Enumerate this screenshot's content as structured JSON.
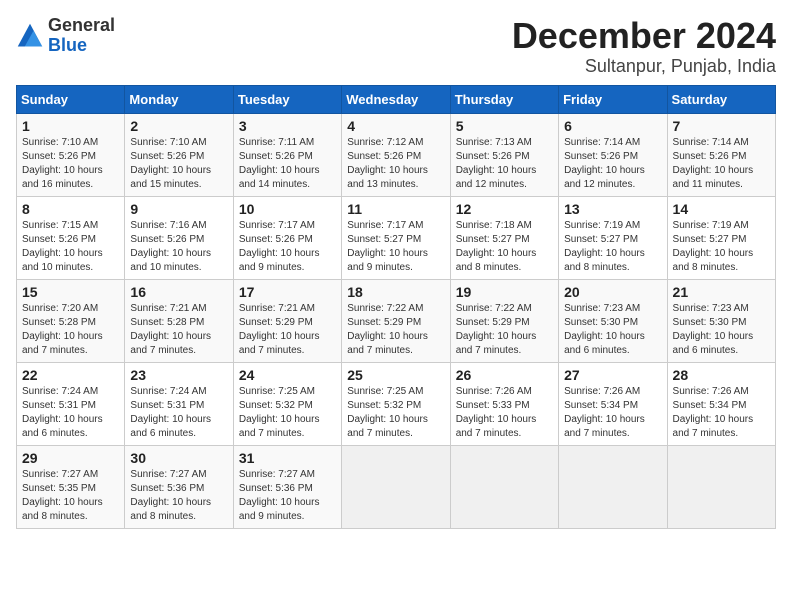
{
  "logo": {
    "general": "General",
    "blue": "Blue"
  },
  "header": {
    "month": "December 2024",
    "location": "Sultanpur, Punjab, India"
  },
  "weekdays": [
    "Sunday",
    "Monday",
    "Tuesday",
    "Wednesday",
    "Thursday",
    "Friday",
    "Saturday"
  ],
  "weeks": [
    [
      {
        "day": "1",
        "sunrise": "7:10 AM",
        "sunset": "5:26 PM",
        "daylight": "10 hours and 16 minutes."
      },
      {
        "day": "2",
        "sunrise": "7:10 AM",
        "sunset": "5:26 PM",
        "daylight": "10 hours and 15 minutes."
      },
      {
        "day": "3",
        "sunrise": "7:11 AM",
        "sunset": "5:26 PM",
        "daylight": "10 hours and 14 minutes."
      },
      {
        "day": "4",
        "sunrise": "7:12 AM",
        "sunset": "5:26 PM",
        "daylight": "10 hours and 13 minutes."
      },
      {
        "day": "5",
        "sunrise": "7:13 AM",
        "sunset": "5:26 PM",
        "daylight": "10 hours and 12 minutes."
      },
      {
        "day": "6",
        "sunrise": "7:14 AM",
        "sunset": "5:26 PM",
        "daylight": "10 hours and 12 minutes."
      },
      {
        "day": "7",
        "sunrise": "7:14 AM",
        "sunset": "5:26 PM",
        "daylight": "10 hours and 11 minutes."
      }
    ],
    [
      {
        "day": "8",
        "sunrise": "7:15 AM",
        "sunset": "5:26 PM",
        "daylight": "10 hours and 10 minutes."
      },
      {
        "day": "9",
        "sunrise": "7:16 AM",
        "sunset": "5:26 PM",
        "daylight": "10 hours and 10 minutes."
      },
      {
        "day": "10",
        "sunrise": "7:17 AM",
        "sunset": "5:26 PM",
        "daylight": "10 hours and 9 minutes."
      },
      {
        "day": "11",
        "sunrise": "7:17 AM",
        "sunset": "5:27 PM",
        "daylight": "10 hours and 9 minutes."
      },
      {
        "day": "12",
        "sunrise": "7:18 AM",
        "sunset": "5:27 PM",
        "daylight": "10 hours and 8 minutes."
      },
      {
        "day": "13",
        "sunrise": "7:19 AM",
        "sunset": "5:27 PM",
        "daylight": "10 hours and 8 minutes."
      },
      {
        "day": "14",
        "sunrise": "7:19 AM",
        "sunset": "5:27 PM",
        "daylight": "10 hours and 8 minutes."
      }
    ],
    [
      {
        "day": "15",
        "sunrise": "7:20 AM",
        "sunset": "5:28 PM",
        "daylight": "10 hours and 7 minutes."
      },
      {
        "day": "16",
        "sunrise": "7:21 AM",
        "sunset": "5:28 PM",
        "daylight": "10 hours and 7 minutes."
      },
      {
        "day": "17",
        "sunrise": "7:21 AM",
        "sunset": "5:29 PM",
        "daylight": "10 hours and 7 minutes."
      },
      {
        "day": "18",
        "sunrise": "7:22 AM",
        "sunset": "5:29 PM",
        "daylight": "10 hours and 7 minutes."
      },
      {
        "day": "19",
        "sunrise": "7:22 AM",
        "sunset": "5:29 PM",
        "daylight": "10 hours and 7 minutes."
      },
      {
        "day": "20",
        "sunrise": "7:23 AM",
        "sunset": "5:30 PM",
        "daylight": "10 hours and 6 minutes."
      },
      {
        "day": "21",
        "sunrise": "7:23 AM",
        "sunset": "5:30 PM",
        "daylight": "10 hours and 6 minutes."
      }
    ],
    [
      {
        "day": "22",
        "sunrise": "7:24 AM",
        "sunset": "5:31 PM",
        "daylight": "10 hours and 6 minutes."
      },
      {
        "day": "23",
        "sunrise": "7:24 AM",
        "sunset": "5:31 PM",
        "daylight": "10 hours and 6 minutes."
      },
      {
        "day": "24",
        "sunrise": "7:25 AM",
        "sunset": "5:32 PM",
        "daylight": "10 hours and 7 minutes."
      },
      {
        "day": "25",
        "sunrise": "7:25 AM",
        "sunset": "5:32 PM",
        "daylight": "10 hours and 7 minutes."
      },
      {
        "day": "26",
        "sunrise": "7:26 AM",
        "sunset": "5:33 PM",
        "daylight": "10 hours and 7 minutes."
      },
      {
        "day": "27",
        "sunrise": "7:26 AM",
        "sunset": "5:34 PM",
        "daylight": "10 hours and 7 minutes."
      },
      {
        "day": "28",
        "sunrise": "7:26 AM",
        "sunset": "5:34 PM",
        "daylight": "10 hours and 7 minutes."
      }
    ],
    [
      {
        "day": "29",
        "sunrise": "7:27 AM",
        "sunset": "5:35 PM",
        "daylight": "10 hours and 8 minutes."
      },
      {
        "day": "30",
        "sunrise": "7:27 AM",
        "sunset": "5:36 PM",
        "daylight": "10 hours and 8 minutes."
      },
      {
        "day": "31",
        "sunrise": "7:27 AM",
        "sunset": "5:36 PM",
        "daylight": "10 hours and 9 minutes."
      },
      null,
      null,
      null,
      null
    ]
  ],
  "labels": {
    "sunrise": "Sunrise:",
    "sunset": "Sunset:",
    "daylight": "Daylight:"
  }
}
